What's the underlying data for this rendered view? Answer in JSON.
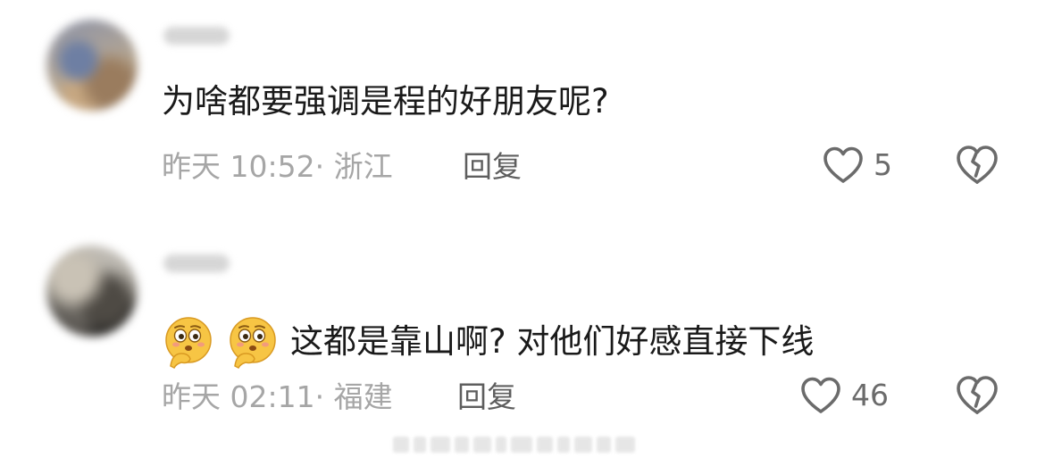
{
  "comments": [
    {
      "text": "为啥都要强调是程的好朋友呢?",
      "time_location": "昨天 10:52· 浙江",
      "reply_label": "回复",
      "like_count": "5",
      "emojis": []
    },
    {
      "text": "这都是靠山啊? 对他们好感直接下线",
      "time_location": "昨天 02:11· 福建",
      "reply_label": "回复",
      "like_count": "46",
      "emojis": [
        "thinking-face-emoji",
        "thinking-face-emoji"
      ]
    }
  ],
  "icons": {
    "like": "heart-outline-icon",
    "dislike": "broken-heart-icon"
  },
  "colors": {
    "text_primary": "#1a1a1a",
    "text_meta": "#a6a6a6",
    "reply": "#5e5e5e",
    "icon": "#6b6b6b"
  }
}
